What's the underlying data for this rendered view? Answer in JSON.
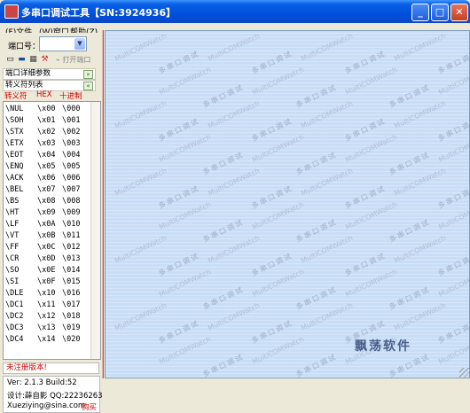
{
  "window": {
    "title": "多串口调试工具【SN:3924936】",
    "buttons": {
      "minimize": "_",
      "maximize": "□",
      "close": "✕"
    }
  },
  "menu": [
    {
      "label": "(F)文件"
    },
    {
      "label": "(W)窗口"
    },
    {
      "label": "帮助(Z)"
    }
  ],
  "port": {
    "label": "端口号：",
    "value": ""
  },
  "toolbar": {
    "open_port": "打开端口"
  },
  "sections": {
    "port_params": "端口详细参数",
    "escape_list": "转义符列表"
  },
  "table": {
    "headers": [
      "转义符",
      "HEX",
      "十进制"
    ],
    "rows": [
      [
        "\\NUL",
        "\\x00",
        "\\000"
      ],
      [
        "\\SOH",
        "\\x01",
        "\\001"
      ],
      [
        "\\STX",
        "\\x02",
        "\\002"
      ],
      [
        "\\ETX",
        "\\x03",
        "\\003"
      ],
      [
        "\\EOT",
        "\\x04",
        "\\004"
      ],
      [
        "\\ENQ",
        "\\x05",
        "\\005"
      ],
      [
        "\\ACK",
        "\\x06",
        "\\006"
      ],
      [
        "\\BEL",
        "\\x07",
        "\\007"
      ],
      [
        "\\BS",
        "\\x08",
        "\\008"
      ],
      [
        "\\HT",
        "\\x09",
        "\\009"
      ],
      [
        "\\LF",
        "\\x0A",
        "\\010"
      ],
      [
        "\\VT",
        "\\x0B",
        "\\011"
      ],
      [
        "\\FF",
        "\\x0C",
        "\\012"
      ],
      [
        "\\CR",
        "\\x0D",
        "\\013"
      ],
      [
        "\\SO",
        "\\x0E",
        "\\014"
      ],
      [
        "\\SI",
        "\\x0F",
        "\\015"
      ],
      [
        "\\DLE",
        "\\x10",
        "\\016"
      ],
      [
        "\\DC1",
        "\\x11",
        "\\017"
      ],
      [
        "\\DC2",
        "\\x12",
        "\\018"
      ],
      [
        "\\DC3",
        "\\x13",
        "\\019"
      ],
      [
        "\\DC4",
        "\\x14",
        "\\020"
      ]
    ]
  },
  "registration": "未注册版本!",
  "info": {
    "version": "Ver: 2.1.3  Build:52",
    "author": "设计:薛自影 QQ:22236263",
    "email": "Xueziying@sina.com",
    "buy": "购买"
  },
  "watermarks": {
    "english": "MultiCOMWatch",
    "chinese": "多串口调试"
  },
  "brand": "飘荡软件",
  "colors": {
    "titlebar": "#0a5fe5",
    "main_bg": "#c9def6",
    "header_red": "#d00000"
  }
}
